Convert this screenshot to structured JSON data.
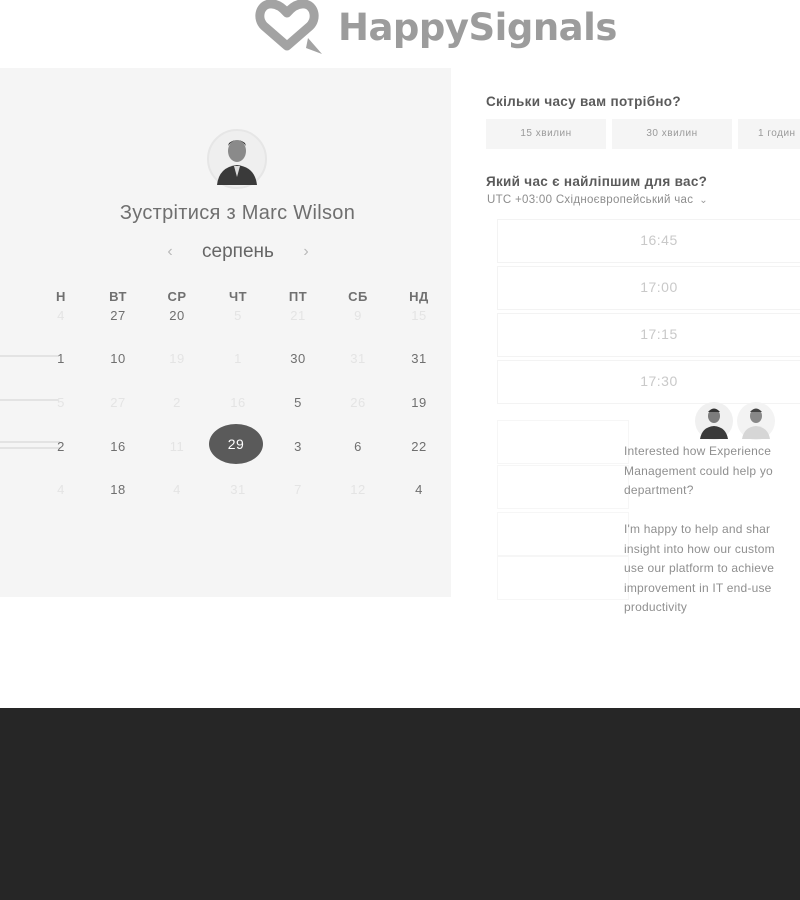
{
  "brand": {
    "name": "HappySignals"
  },
  "host": {
    "title": "Зустрітися з Marc Wilson"
  },
  "calendar": {
    "month": "серпень",
    "weekdays": [
      "Н",
      "ВТ",
      "СР",
      "ЧТ",
      "ПТ",
      "СБ",
      "НД"
    ],
    "rows": [
      [
        "4",
        "27",
        "20",
        "5",
        "21",
        "9",
        "15"
      ],
      [
        "1",
        "10",
        "19",
        "1",
        "30",
        "31",
        "31"
      ],
      [
        "5",
        "27",
        "2",
        "16",
        "5",
        "26",
        "19"
      ],
      [
        "2",
        "16",
        "11",
        "29",
        "3",
        "6",
        "22"
      ],
      [
        "4",
        "18",
        "4",
        "31",
        "7",
        "12",
        "4"
      ]
    ],
    "selected": "29"
  },
  "duration": {
    "question": "Скільки часу вам потрібно?",
    "options": [
      "15 хвилин",
      "30 хвилин",
      "1 годин"
    ]
  },
  "time": {
    "question": "Який час є найліпшим для вас?",
    "timezone": "UTC +03:00 Східноєвропейський час",
    "slots": [
      "16:45",
      "17:00",
      "17:15",
      "17:30"
    ]
  },
  "chat": {
    "message": "Interested how Experience\nManagement could help yo\ndepartment?\n\nI'm happy to help and shar\ninsight into how our custom\nuse our platform to achieve\nimprovement in IT end-use\nproductivity"
  },
  "colors": {
    "footer": "#262626",
    "panel": "#f5f5f5",
    "selected_day": "#5a5a5a",
    "logo": "#9c9c9c"
  }
}
